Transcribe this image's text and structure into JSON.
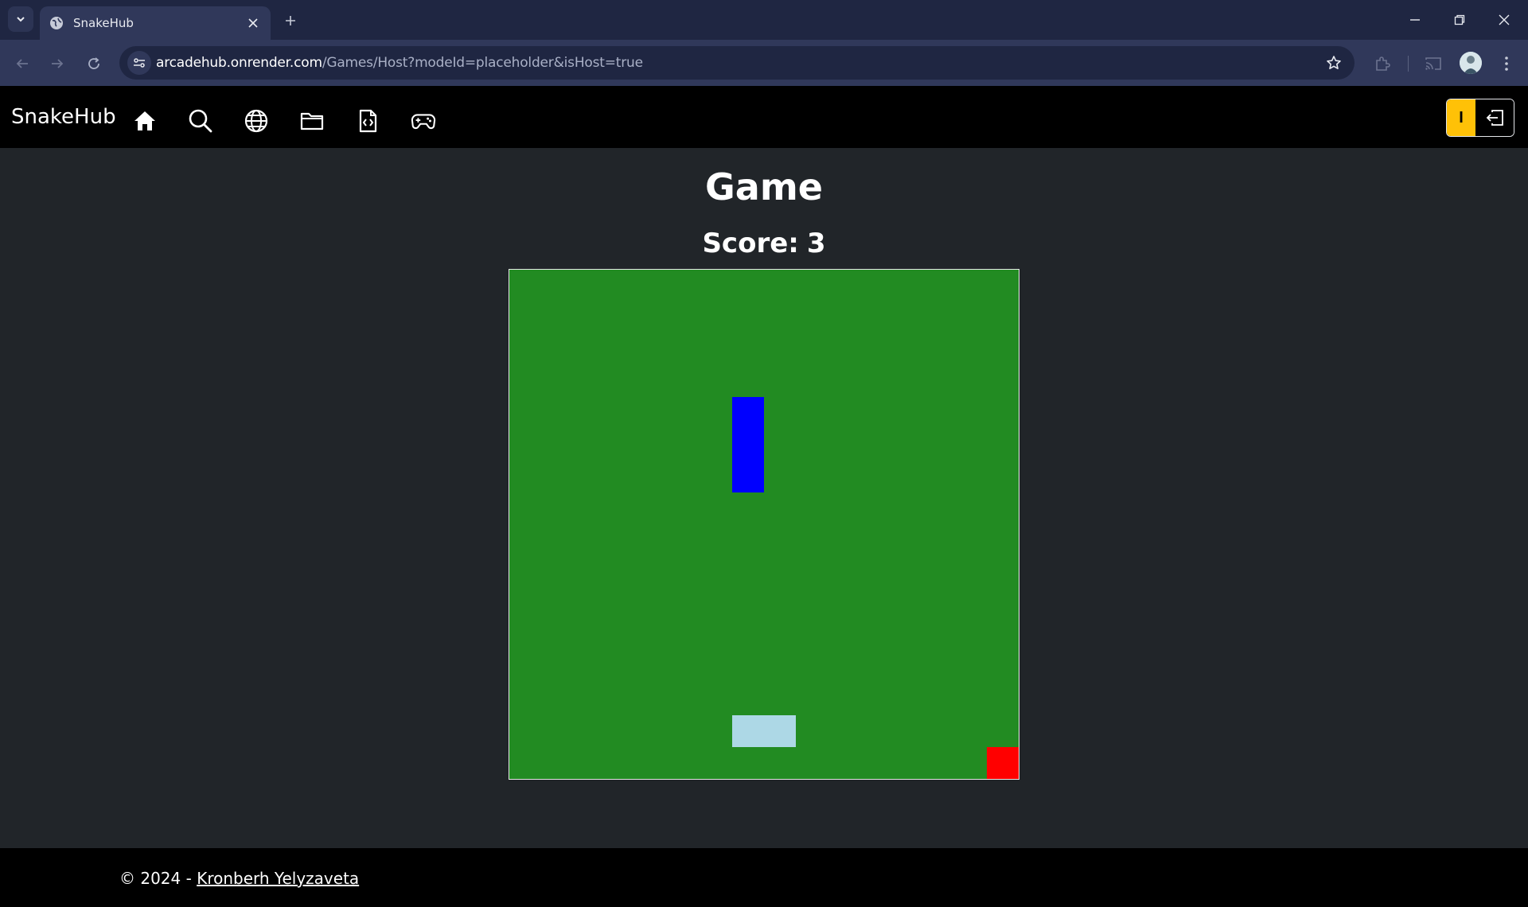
{
  "browser": {
    "tab_title": "SnakeHub",
    "url_host": "arcadehub.onrender.com",
    "url_path": "/Games/Host?modeId=placeholder&isHost=true"
  },
  "navbar": {
    "brand": "SnakeHub",
    "icons": [
      "home-icon",
      "search-icon",
      "globe-icon",
      "folder-icon",
      "code-file-icon",
      "gamepad-icon"
    ],
    "user_initial": "I",
    "accent_color": "#ffc107"
  },
  "main": {
    "title": "Game",
    "score_label": "Score:",
    "score_value": "3"
  },
  "game": {
    "grid_size": 16,
    "board_color": "#228b22",
    "entities": [
      {
        "name": "blue-paddle",
        "color": "#0000ff",
        "col": 7,
        "row": 4,
        "w": 1,
        "h": 3
      },
      {
        "name": "lightblue-paddle",
        "color": "#add8e6",
        "col": 7,
        "row": 14,
        "w": 2,
        "h": 1
      },
      {
        "name": "red-food",
        "color": "#ff0000",
        "col": 15,
        "row": 15,
        "w": 1,
        "h": 1
      }
    ]
  },
  "footer": {
    "copyright": "© 2024 -",
    "author_link": "Kronberh Yelyzaveta"
  }
}
